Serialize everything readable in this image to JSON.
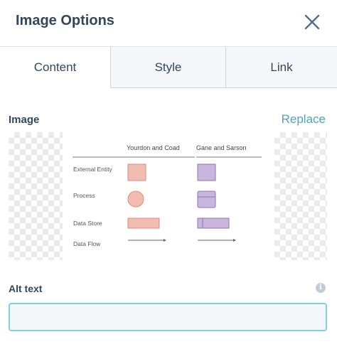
{
  "dialog": {
    "title": "Image Options",
    "close_icon": "close-icon"
  },
  "tabs": [
    {
      "label": "Content",
      "active": true
    },
    {
      "label": "Style",
      "active": false
    },
    {
      "label": "Link",
      "active": false
    }
  ],
  "image_section": {
    "label": "Image",
    "replace_label": "Replace"
  },
  "preview_figure": {
    "columns": [
      "Yourdon and Coad",
      "Gane and Sarson"
    ],
    "rows": [
      "External Entity",
      "Process",
      "Data Store",
      "Data Flow"
    ],
    "colors": {
      "yourdon_fill": "#f3bcb0",
      "yourdon_stroke": "#d98c80",
      "gane_fill": "#c9b6df",
      "gane_stroke": "#8e76b3"
    }
  },
  "alt_text": {
    "label": "Alt text",
    "value": "",
    "placeholder": "",
    "info_icon": "info-icon"
  },
  "colors": {
    "accent": "#4fa6b8",
    "input_border": "#7fd1de",
    "text": "#33475b"
  }
}
